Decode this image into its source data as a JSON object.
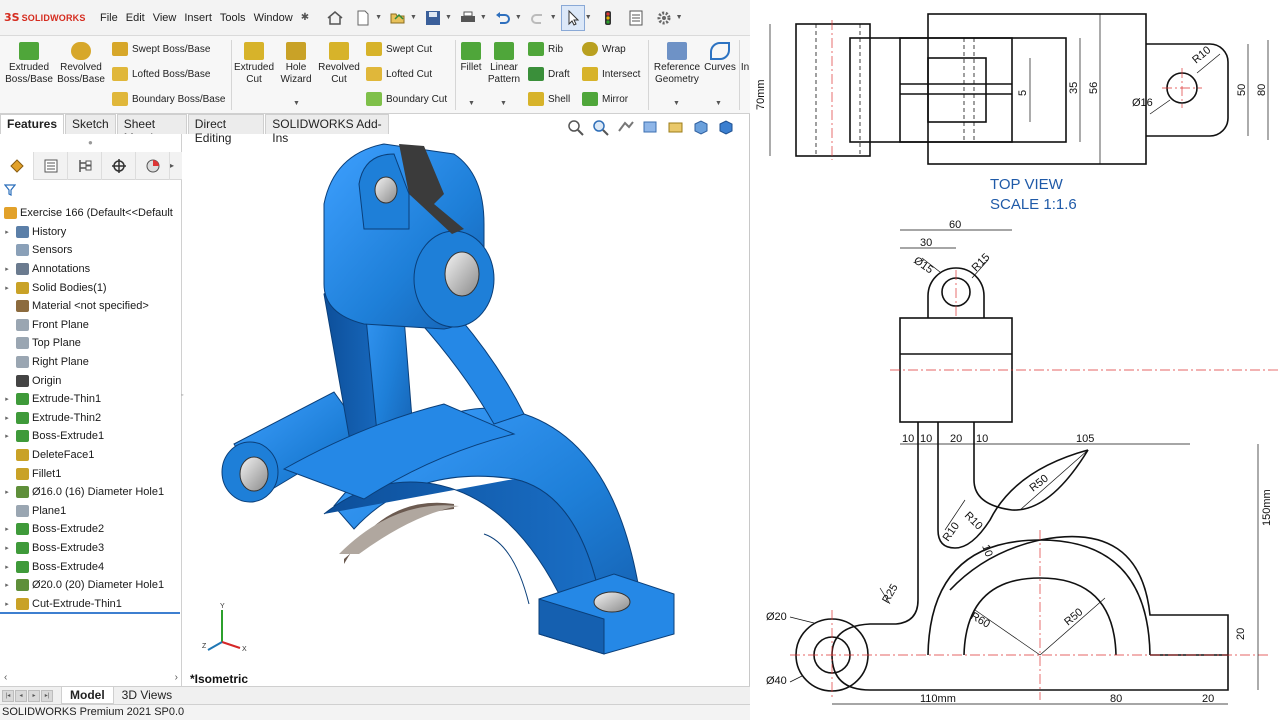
{
  "app": {
    "logo_ds": "3S",
    "logo_name": "SOLIDWORKS",
    "menu": [
      "File",
      "Edit",
      "View",
      "Insert",
      "Tools",
      "Window"
    ],
    "status": "SOLIDWORKS Premium 2021 SP0.0"
  },
  "ribbon": {
    "extruded_boss": "Extruded\nBoss/Base",
    "revolved_boss": "Revolved\nBoss/Base",
    "swept_boss": "Swept Boss/Base",
    "lofted_boss": "Lofted Boss/Base",
    "boundary_boss": "Boundary Boss/Base",
    "extruded_cut": "Extruded\nCut",
    "hole_wizard": "Hole\nWizard",
    "revolved_cut": "Revolved\nCut",
    "swept_cut": "Swept Cut",
    "lofted_cut": "Lofted Cut",
    "boundary_cut": "Boundary Cut",
    "fillet": "Fillet",
    "linear_pattern": "Linear\nPattern",
    "rib": "Rib",
    "draft": "Draft",
    "shell": "Shell",
    "wrap": "Wrap",
    "intersect": "Intersect",
    "mirror": "Mirror",
    "ref_geometry": "Reference\nGeometry",
    "curves": "Curves",
    "instant": "In"
  },
  "tabs": [
    "Features",
    "Sketch",
    "Sheet Metal",
    "Direct Editing",
    "SOLIDWORKS Add-Ins"
  ],
  "tree": {
    "root": "Exercise 166  (Default<<Default",
    "items": [
      {
        "label": "History",
        "arrow": true,
        "color": "#5b7fa8"
      },
      {
        "label": "Sensors",
        "arrow": false,
        "color": "#8aa0b8"
      },
      {
        "label": "Annotations",
        "arrow": true,
        "color": "#6b7b8f"
      },
      {
        "label": "Solid Bodies(1)",
        "arrow": true,
        "color": "#c9a227"
      },
      {
        "label": "Material <not specified>",
        "arrow": false,
        "color": "#8c6b3e"
      },
      {
        "label": "Front Plane",
        "arrow": false,
        "color": "#9aa6b2"
      },
      {
        "label": "Top Plane",
        "arrow": false,
        "color": "#9aa6b2"
      },
      {
        "label": "Right Plane",
        "arrow": false,
        "color": "#9aa6b2"
      },
      {
        "label": "Origin",
        "arrow": false,
        "color": "#444444"
      },
      {
        "label": "Extrude-Thin1",
        "arrow": true,
        "color": "#3f9a3a"
      },
      {
        "label": "Extrude-Thin2",
        "arrow": true,
        "color": "#3f9a3a"
      },
      {
        "label": "Boss-Extrude1",
        "arrow": true,
        "color": "#3f9a3a"
      },
      {
        "label": "DeleteFace1",
        "arrow": false,
        "color": "#c9a227"
      },
      {
        "label": "Fillet1",
        "arrow": false,
        "color": "#c9a227"
      },
      {
        "label": "Ø16.0 (16) Diameter Hole1",
        "arrow": true,
        "color": "#5f8f3a"
      },
      {
        "label": "Plane1",
        "arrow": false,
        "color": "#9aa6b2"
      },
      {
        "label": "Boss-Extrude2",
        "arrow": true,
        "color": "#3f9a3a"
      },
      {
        "label": "Boss-Extrude3",
        "arrow": true,
        "color": "#3f9a3a"
      },
      {
        "label": "Boss-Extrude4",
        "arrow": true,
        "color": "#3f9a3a"
      },
      {
        "label": "Ø20.0 (20) Diameter Hole1",
        "arrow": true,
        "color": "#5f8f3a"
      },
      {
        "label": "Cut-Extrude-Thin1",
        "arrow": true,
        "color": "#c9a227"
      }
    ]
  },
  "viewport": {
    "view_name": "*Isometric",
    "model_color": "#1e7fd8"
  },
  "bottom_tabs": [
    "Model",
    "3D Views"
  ],
  "drawing": {
    "top_view_caption": "TOP VIEW",
    "top_view_scale": "SCALE 1:1.6",
    "dims": {
      "d70mm": "70mm",
      "d5": "5",
      "d35": "35",
      "d56": "56",
      "d50": "50",
      "d80": "80",
      "r10_top": "R10",
      "dia16": "Ø16",
      "d60": "60",
      "d30": "30",
      "dia15": "Ø15",
      "r15": "R15",
      "d10a": "10",
      "d10b": "10",
      "d20": "20",
      "d10c": "10",
      "d105": "105",
      "r50a": "R50",
      "r10a": "R10",
      "r10b": "R10",
      "d10d": "10",
      "d150mm": "150mm",
      "r25": "R25",
      "dia20": "Ø20",
      "r60": "R60",
      "r50b": "R50",
      "d20r": "20",
      "dia40": "Ø40",
      "d110mm": "110mm",
      "d80b": "80",
      "d20b": "20"
    }
  }
}
